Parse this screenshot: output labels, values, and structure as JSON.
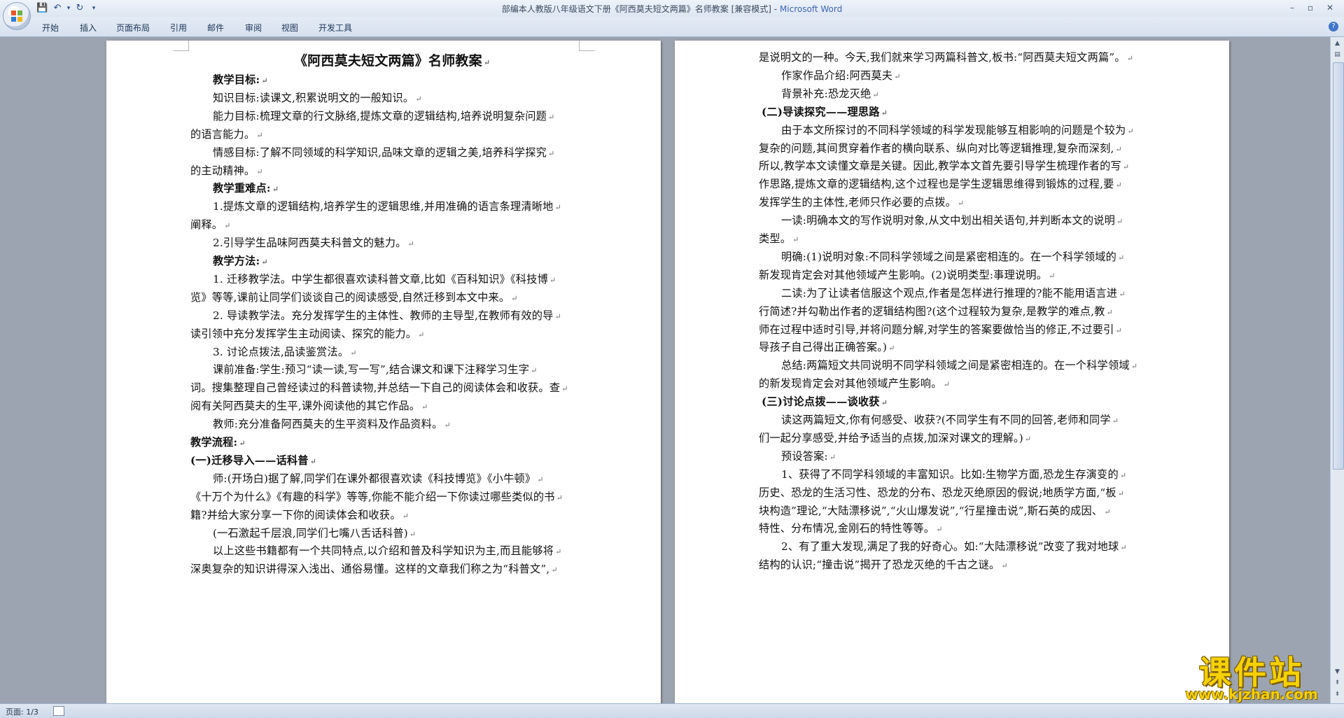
{
  "window": {
    "title_doc": "部编本人教版八年级语文下册《阿西莫夫短文两篇》名师教案 [兼容模式] - ",
    "title_app": "Microsoft Word",
    "minimize": "–",
    "maximize": "▫",
    "close": "✕"
  },
  "ribbon": {
    "tabs": [
      "开始",
      "插入",
      "页面布局",
      "引用",
      "邮件",
      "审阅",
      "视图",
      "开发工具"
    ]
  },
  "status": {
    "page": "页面: 1/3"
  },
  "watermark": {
    "main": "课件站",
    "url": "www.kjzhan.com"
  },
  "page1": [
    {
      "t": "《阿西莫夫短文两篇》名师教案",
      "s": "title"
    },
    {
      "t": "教学目标:",
      "s": "b"
    },
    {
      "t": "知识目标:读课文,积累说明文的一般知识。",
      "s": ""
    },
    {
      "t": "能力目标:梳理文章的行文脉络,提炼文章的逻辑结构,培养说明复杂问题",
      "s": ""
    },
    {
      "t": "的语言能力。",
      "s": ""
    },
    {
      "t": "情感目标:了解不同领域的科学知识,品味文章的逻辑之美,培养科学探究",
      "s": ""
    },
    {
      "t": "的主动精神。",
      "s": ""
    },
    {
      "t": "教学重难点:",
      "s": "b"
    },
    {
      "t": "1.提炼文章的逻辑结构,培养学生的逻辑思维,并用准确的语言条理清晰地",
      "s": ""
    },
    {
      "t": "阐释。",
      "s": ""
    },
    {
      "t": "2.引导学生品味阿西莫夫科普文的魅力。",
      "s": ""
    },
    {
      "t": "教学方法:",
      "s": "b"
    },
    {
      "t": "1. 迁移教学法。中学生都很喜欢读科普文章,比如《百科知识》《科技博",
      "s": ""
    },
    {
      "t": "览》等等,课前让同学们谈谈自己的阅读感受,自然迁移到本文中来。",
      "s": ""
    },
    {
      "t": "2. 导读教学法。充分发挥学生的主体性、教师的主导型,在教师有效的导",
      "s": ""
    },
    {
      "t": "读引领中充分发挥学生主动阅读、探究的能力。",
      "s": ""
    },
    {
      "t": "3. 讨论点拨法,品读鉴赏法。",
      "s": ""
    },
    {
      "t": "课前准备:学生:预习“读一读,写一写”,结合课文和课下注释学习生字",
      "s": ""
    },
    {
      "t": "词。搜集整理自己曾经读过的科普读物,并总结一下自己的阅读体会和收获。查",
      "s": ""
    },
    {
      "t": "阅有关阿西莫夫的生平,课外阅读他的其它作品。",
      "s": ""
    },
    {
      "t": "教师:充分准备阿西莫夫的生平资料及作品资料。",
      "s": ""
    },
    {
      "t": "教学流程:",
      "s": "b"
    },
    {
      "t": "(一)迁移导入——话科普",
      "s": "b"
    },
    {
      "t": "师:(开场白)据了解,同学们在课外都很喜欢读《科技博览》《小牛顿》",
      "s": ""
    },
    {
      "t": "《十万个为什么》《有趣的科学》等等,你能不能介绍一下你读过哪些类似的书",
      "s": ""
    },
    {
      "t": "籍?并给大家分享一下你的阅读体会和收获。",
      "s": ""
    },
    {
      "t": "(一石激起千层浪,同学们七嘴八舌话科普)",
      "s": ""
    },
    {
      "t": "以上这些书籍都有一个共同特点,以介绍和普及科学知识为主,而且能够将",
      "s": ""
    },
    {
      "t": "深奥复杂的知识讲得深入浅出、通俗易懂。这样的文章我们称之为“科普文”,",
      "s": ""
    }
  ],
  "page2": [
    {
      "t": "是说明文的一种。今天,我们就来学习两篇科普文,板书:“阿西莫夫短文两篇”。",
      "s": ""
    },
    {
      "t": "作家作品介绍:阿西莫夫",
      "s": ""
    },
    {
      "t": "背景补充:恐龙灭绝",
      "s": ""
    },
    {
      "t": "(二)导读探究——理思路",
      "s": "b"
    },
    {
      "t": "由于本文所探讨的不同科学领域的科学发现能够互相影响的问题是个较为",
      "s": ""
    },
    {
      "t": "复杂的问题,其间贯穿着作者的横向联系、纵向对比等逻辑推理,复杂而深刻,",
      "s": ""
    },
    {
      "t": "所以,教学本文读懂文章是关键。因此,教学本文首先要引导学生梳理作者的写",
      "s": ""
    },
    {
      "t": "作思路,提炼文章的逻辑结构,这个过程也是学生逻辑思维得到锻炼的过程,要",
      "s": ""
    },
    {
      "t": "发挥学生的主体性,老师只作必要的点拨。",
      "s": ""
    },
    {
      "t": "一读:明确本文的写作说明对象,从文中划出相关语句,并判断本文的说明",
      "s": ""
    },
    {
      "t": "类型。",
      "s": ""
    },
    {
      "t": "明确:(1)说明对象:不同科学领域之间是紧密相连的。在一个科学领域的",
      "s": ""
    },
    {
      "t": "新发现肯定会对其他领域产生影响。(2)说明类型:事理说明。",
      "s": ""
    },
    {
      "t": "二读:为了让读者信服这个观点,作者是怎样进行推理的?能不能用语言进",
      "s": ""
    },
    {
      "t": "行简述?并勾勒出作者的逻辑结构图?(这个过程较为复杂,是教学的难点,教",
      "s": ""
    },
    {
      "t": "师在过程中适时引导,并将问题分解,对学生的答案要做恰当的修正,不过要引",
      "s": ""
    },
    {
      "t": "导孩子自己得出正确答案。)",
      "s": ""
    },
    {
      "t": "总结:两篇短文共同说明不同学科领域之间是紧密相连的。在一个科学领域",
      "s": ""
    },
    {
      "t": "的新发现肯定会对其他领域产生影响。",
      "s": ""
    },
    {
      "t": "(三)讨论点拨——谈收获",
      "s": "b"
    },
    {
      "t": "读这两篇短文,你有何感受、收获?(不同学生有不同的回答,老师和同学",
      "s": ""
    },
    {
      "t": "们一起分享感受,并给予适当的点拨,加深对课文的理解。)",
      "s": ""
    },
    {
      "t": "预设答案:",
      "s": ""
    },
    {
      "t": "1、获得了不同学科领域的丰富知识。比如:生物学方面,恐龙生存演变的",
      "s": ""
    },
    {
      "t": "历史、恐龙的生活习性、恐龙的分布、恐龙灭绝原因的假说;地质学方面,“板",
      "s": ""
    },
    {
      "t": "块构造”理论,“大陆漂移说”,“火山爆发说”,“行星撞击说”,斯石英的成因、",
      "s": ""
    },
    {
      "t": "特性、分布情况,金刚石的特性等等。",
      "s": ""
    },
    {
      "t": "2、有了重大发现,满足了我的好奇心。如:“大陆漂移说”改变了我对地球",
      "s": ""
    },
    {
      "t": "结构的认识;“撞击说”揭开了恐龙灭绝的千古之谜。",
      "s": ""
    }
  ]
}
